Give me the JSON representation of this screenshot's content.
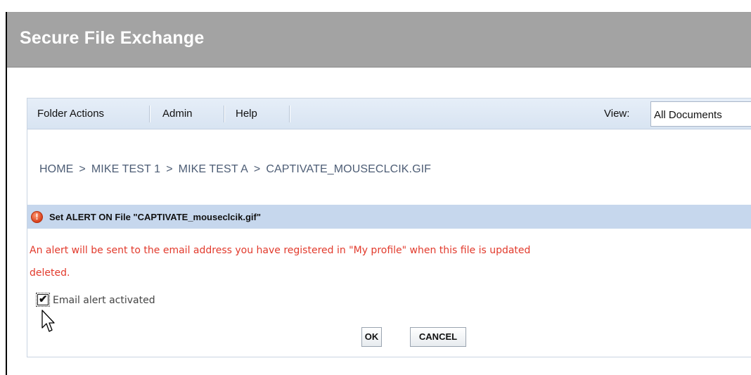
{
  "app": {
    "title": "Secure File Exchange"
  },
  "menu": {
    "items": [
      {
        "label": "Folder Actions"
      },
      {
        "label": "Admin"
      },
      {
        "label": "Help"
      }
    ],
    "view_label": "View:",
    "view_value": "All Documents"
  },
  "breadcrumb": {
    "items": [
      "HOME",
      "MIKE TEST 1",
      "MIKE TEST A",
      "CAPTIVATE_MOUSECLCIK.GIF"
    ],
    "separator": ">"
  },
  "alert": {
    "title": "Set ALERT ON File \"CAPTIVATE_mouseclcik.gif\"",
    "message_line1": "An alert will be sent to the email address you have registered in \"My profile\" when this file is updated",
    "message_line2": "deleted.",
    "icon": "alert-icon"
  },
  "checkbox": {
    "label": "Email alert activated",
    "checked": true
  },
  "buttons": {
    "ok": "OK",
    "cancel": "CANCEL"
  },
  "colors": {
    "header_bg": "#a3a3a3",
    "toolbar_bg": "#dde7f4",
    "alert_bar_bg": "#c6d7ed",
    "message_text": "#e23a2c",
    "breadcrumb_text": "#4d5d75"
  }
}
